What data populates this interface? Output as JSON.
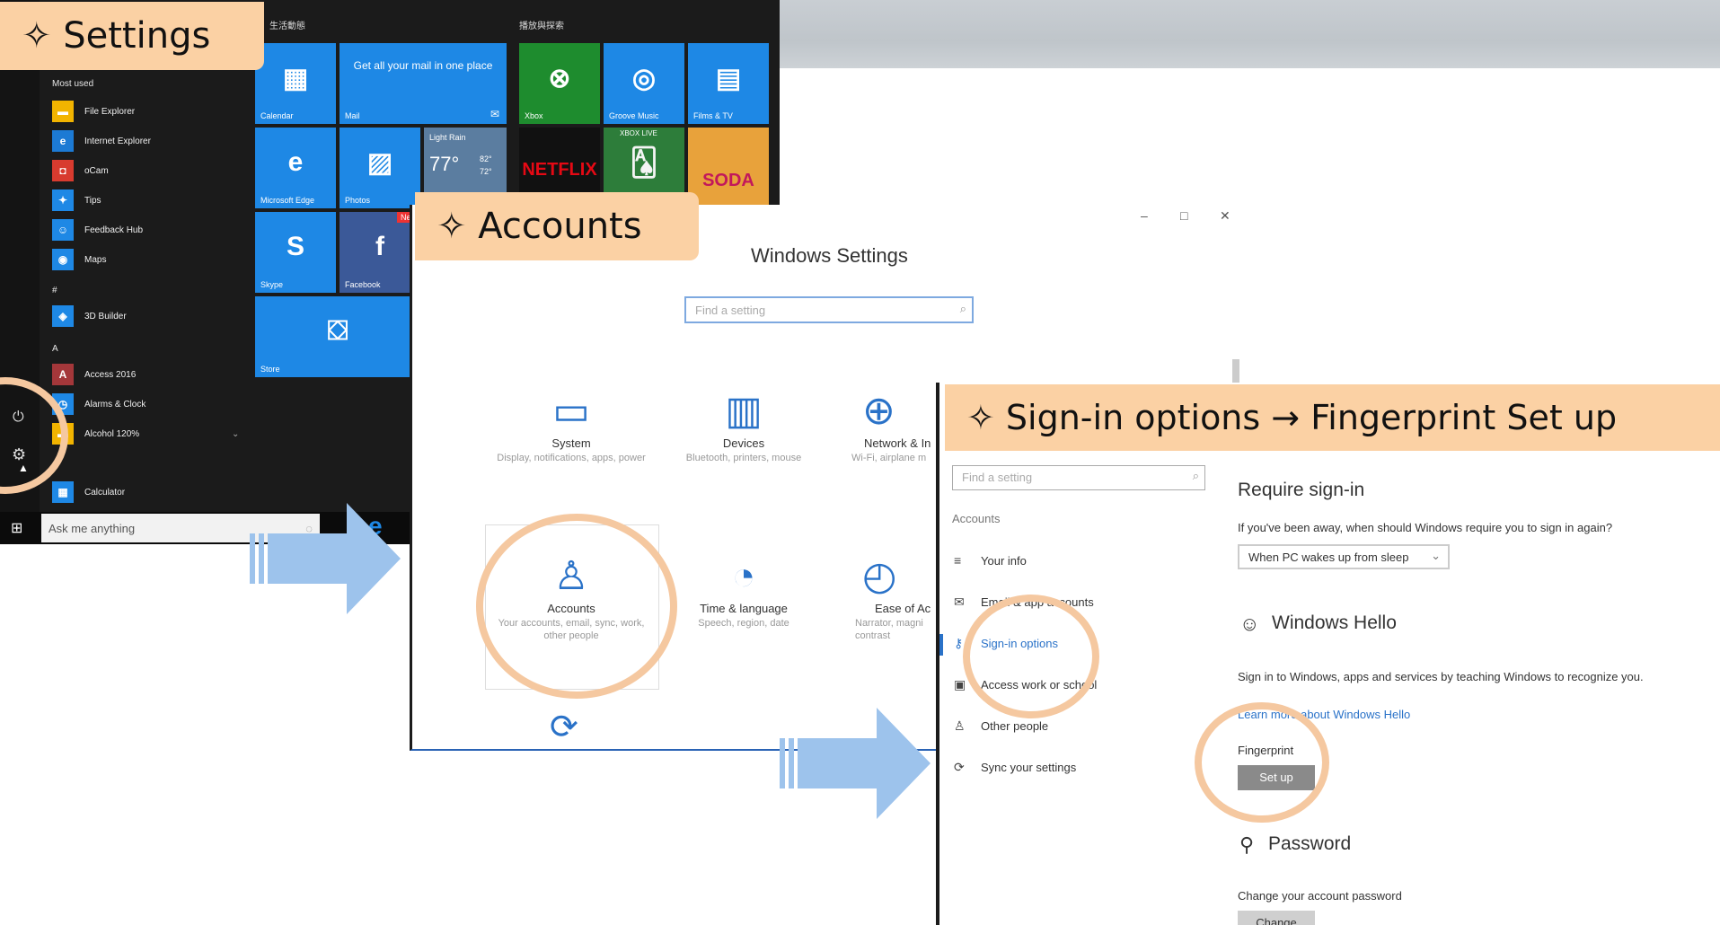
{
  "callouts": {
    "settings": "✧ Settings",
    "accounts": "✧ Accounts",
    "signin": "✧ Sign-in options → Fingerprint Set up"
  },
  "start_menu": {
    "most_used_label": "Most used",
    "group_hash": "#",
    "group_a": "A",
    "items": {
      "file_explorer": "File Explorer",
      "internet_explorer": "Internet Explorer",
      "ocam": "oCam",
      "tips": "Tips",
      "feedback_hub": "Feedback Hub",
      "maps": "Maps",
      "builder": "3D Builder",
      "access": "Access 2016",
      "alarms": "Alarms & Clock",
      "alcohol": "Alcohol 120%",
      "calculator": "Calculator"
    },
    "tile_group_1": "生活動態",
    "tile_group_2": "播放與探索",
    "tiles": {
      "calendar": "Calendar",
      "mail_text": "Get all your mail in one place",
      "mail": "Mail",
      "xbox": "Xbox",
      "groove": "Groove Music",
      "films": "Films & TV",
      "edge": "Microsoft Edge",
      "photos": "Photos",
      "weather_title": "Light Rain",
      "weather_temp": "77°",
      "weather_hi": "82°",
      "weather_lo": "72°",
      "netflix": "NETFLIX",
      "xbox_live": "XBOX LIVE",
      "candy": "SODA",
      "skype": "Skype",
      "facebook": "Facebook",
      "facebook_badge": "New",
      "store": "Store"
    },
    "search_placeholder": "Ask me anything"
  },
  "windows_settings": {
    "title": "Windows Settings",
    "search_placeholder": "Find a setting",
    "categories": {
      "system": {
        "name": "System",
        "desc": "Display, notifications, apps, power"
      },
      "devices": {
        "name": "Devices",
        "desc": "Bluetooth, printers, mouse"
      },
      "network": {
        "name": "Network & In",
        "desc": "Wi-Fi, airplane m"
      },
      "accounts": {
        "name": "Accounts",
        "desc": "Your accounts, email, sync, work, other people"
      },
      "time": {
        "name": "Time & language",
        "desc": "Speech, region, date"
      },
      "ease": {
        "name": "Ease of Ac",
        "desc": "Narrator, magni contrast"
      }
    }
  },
  "signin_window": {
    "search_placeholder": "Find a setting",
    "section": "Accounts",
    "nav": {
      "your_info": "Your info",
      "email": "Email & app accounts",
      "signin": "Sign-in options",
      "work": "Access work or school",
      "other": "Other people",
      "sync": "Sync your settings"
    },
    "require_title": "Require sign-in",
    "require_desc": "If you've been away, when should Windows require you to sign in again?",
    "require_value": "When PC wakes up from sleep",
    "hello_title": "Windows Hello",
    "hello_desc": "Sign in to Windows, apps and services by teaching Windows to recognize you.",
    "hello_link": "Learn more about Windows Hello",
    "fingerprint_label": "Fingerprint",
    "setup_button": "Set up",
    "password_title": "Password",
    "password_desc": "Change your account password",
    "change_button": "Change"
  }
}
